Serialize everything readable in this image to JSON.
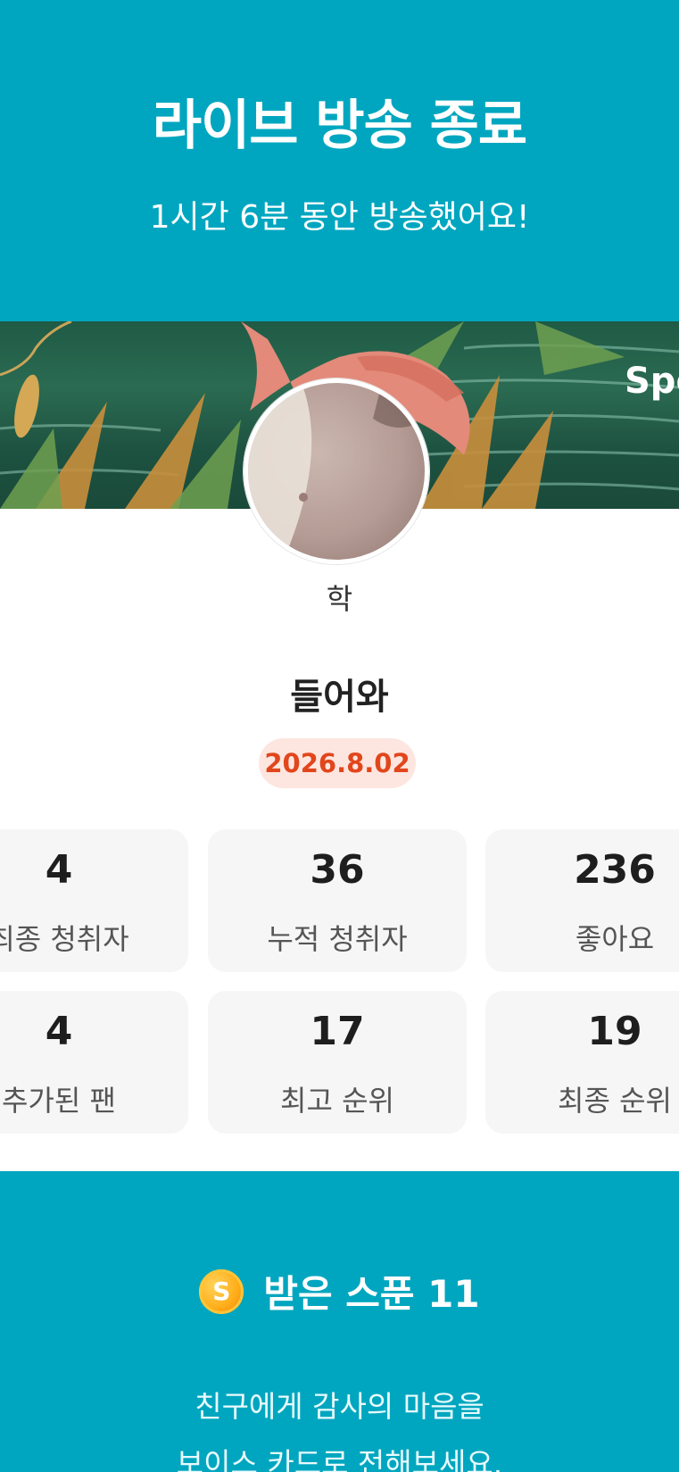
{
  "header": {
    "title": "라이브 방송 종료",
    "subtitle": "1시간 6분 동안 방송했어요!"
  },
  "cover": {
    "partial_text": "Spo"
  },
  "profile": {
    "username": "학",
    "broadcast_title": "들어와",
    "date": "2026.8.02"
  },
  "stats": [
    {
      "value": "4",
      "label": "최종 청취자"
    },
    {
      "value": "36",
      "label": "누적 청취자"
    },
    {
      "value": "236",
      "label": "좋아요"
    },
    {
      "value": "4",
      "label": "추가된 팬"
    },
    {
      "value": "17",
      "label": "최고 순위"
    },
    {
      "value": "19",
      "label": "최종 순위"
    }
  ],
  "spoon": {
    "icon": "spoon-coin-icon",
    "icon_letter": "S",
    "label": "받은 스푼",
    "count": "11"
  },
  "thanks": {
    "line1": "친구에게 감사의 마음을",
    "line2": "보이스 카드로 전해보세요."
  },
  "colors": {
    "brand_teal": "#00a6bf",
    "date_text": "#e2461c",
    "date_bg": "#fde6e0",
    "card_bg": "#f6f6f6"
  }
}
